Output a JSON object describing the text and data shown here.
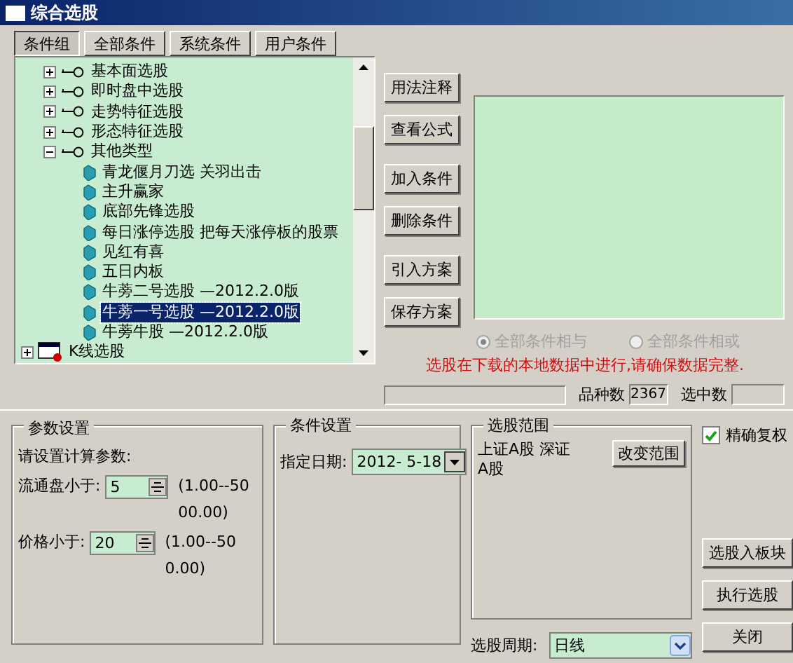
{
  "window": {
    "title": "综合选股"
  },
  "tabs": [
    {
      "label": "条件组",
      "selected": true
    },
    {
      "label": "全部条件",
      "selected": false
    },
    {
      "label": "系统条件",
      "selected": false
    },
    {
      "label": "用户条件",
      "selected": false
    }
  ],
  "tree": [
    {
      "kind": "group",
      "label": "基本面选股",
      "expanded": false
    },
    {
      "kind": "group",
      "label": "即时盘中选股",
      "expanded": false
    },
    {
      "kind": "group",
      "label": "走势特征选股",
      "expanded": false
    },
    {
      "kind": "group",
      "label": "形态特征选股",
      "expanded": false
    },
    {
      "kind": "group",
      "label": "其他类型",
      "expanded": true,
      "children": [
        {
          "kind": "formula",
          "label": "青龙偃月刀选 关羽出击",
          "selected": false
        },
        {
          "kind": "formula",
          "label": "主升赢家",
          "selected": false
        },
        {
          "kind": "formula",
          "label": "底部先锋选股",
          "selected": false
        },
        {
          "kind": "formula",
          "label": "每日涨停选股 把每天涨停板的股票",
          "selected": false
        },
        {
          "kind": "formula",
          "label": "见红有喜",
          "selected": false
        },
        {
          "kind": "formula",
          "label": "五日内板",
          "selected": false
        },
        {
          "kind": "formula",
          "label": "牛蒡二号选股 —2012.2.0版",
          "selected": false
        },
        {
          "kind": "formula",
          "label": "牛蒡一号选股 —2012.2.0版",
          "selected": true
        },
        {
          "kind": "formula",
          "label": "牛蒡牛股 —2012.2.0版",
          "selected": false
        }
      ]
    },
    {
      "kind": "module",
      "label": "K线选股",
      "expanded": false
    }
  ],
  "side_buttons": [
    [
      "用法注释",
      "查看公式"
    ],
    [
      "加入条件",
      "删除条件"
    ],
    [
      "引入方案",
      "保存方案"
    ]
  ],
  "combine_options": [
    {
      "label": "全部条件相与",
      "selected": true,
      "disabled": true
    },
    {
      "label": "全部条件相或",
      "selected": false,
      "disabled": true
    }
  ],
  "notice": "选股在下载的本地数据中进行,请确保数据完整.",
  "status": {
    "count_label": "品种数",
    "count": "2367",
    "selected_label": "选中数"
  },
  "params": {
    "title": "参数设置",
    "prompt": "请设置计算参数:",
    "fields": [
      {
        "label": "流通盘小于:",
        "value": "5",
        "range": "(1.00--5000.00)"
      },
      {
        "label": "价格小于:",
        "value": "20",
        "range": "(1.00--500.00)"
      }
    ]
  },
  "conditions": {
    "title": "条件设置",
    "date_label": "指定日期:",
    "date": "2012- 5-18"
  },
  "scope": {
    "title": "选股范围",
    "text": "上证A股 深证A股",
    "button": "改变范围"
  },
  "period": {
    "label": "选股周期:",
    "value": "日线"
  },
  "exact_adjust": {
    "label": "精确复权",
    "checked": true
  },
  "action_buttons": [
    "选股入板块",
    "执行选股",
    "关闭"
  ]
}
